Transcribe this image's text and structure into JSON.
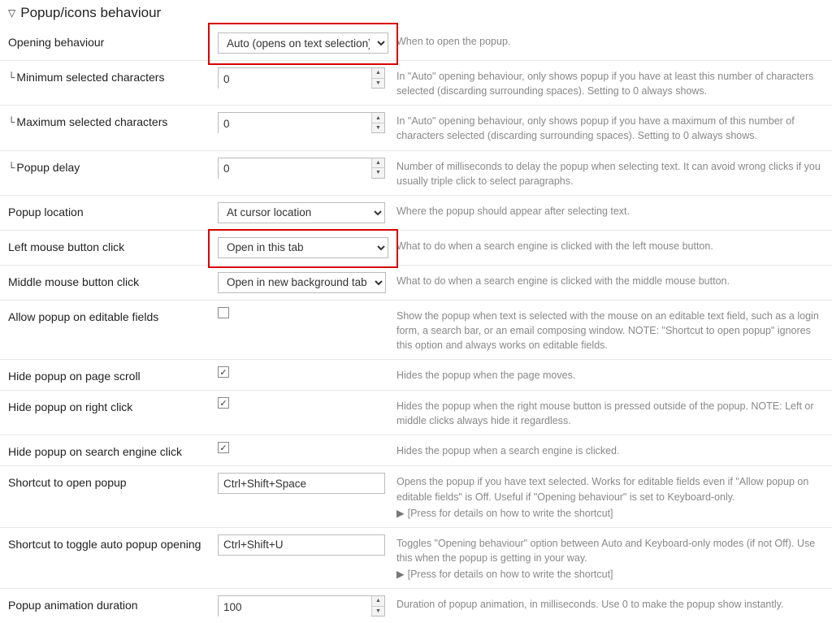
{
  "section": {
    "title": "Popup/icons behaviour"
  },
  "rows": {
    "opening": {
      "label": "Opening behaviour",
      "value": "Auto (opens on text selection)",
      "desc": "When to open the popup."
    },
    "minchars": {
      "label": "Minimum selected characters",
      "value": "0",
      "desc": "In \"Auto\" opening behaviour, only shows popup if you have at least this number of characters selected (discarding surrounding spaces). Setting to 0 always shows."
    },
    "maxchars": {
      "label": "Maximum selected characters",
      "value": "0",
      "desc": "In \"Auto\" opening behaviour, only shows popup if you have a maximum of this number of characters selected (discarding surrounding spaces). Setting to 0 always shows."
    },
    "delay": {
      "label": "Popup delay",
      "value": "0",
      "desc": "Number of milliseconds to delay the popup when selecting text. It can avoid wrong clicks if you usually triple click to select paragraphs."
    },
    "location": {
      "label": "Popup location",
      "value": "At cursor location",
      "desc": "Where the popup should appear after selecting text."
    },
    "leftclick": {
      "label": "Left mouse button click",
      "value": "Open in this tab",
      "desc": "What to do when a search engine is clicked with the left mouse button."
    },
    "middleclick": {
      "label": "Middle mouse button click",
      "value": "Open in new background tab",
      "desc": "What to do when a search engine is clicked with the middle mouse button."
    },
    "allowedit": {
      "label": "Allow popup on editable fields",
      "checked": false,
      "desc": "Show the popup when text is selected with the mouse on an editable text field, such as a login form, a search bar, or an email composing window. NOTE: \"Shortcut to open popup\" ignores this option and always works on editable fields."
    },
    "hidescroll": {
      "label": "Hide popup on page scroll",
      "checked": true,
      "desc": "Hides the popup when the page moves."
    },
    "hideright": {
      "label": "Hide popup on right click",
      "checked": true,
      "desc": "Hides the popup when the right mouse button is pressed outside of the popup. NOTE: Left or middle clicks always hide it regardless."
    },
    "hidesearch": {
      "label": "Hide popup on search engine click",
      "checked": true,
      "desc": "Hides the popup when a search engine is clicked."
    },
    "shortcutopen": {
      "label": "Shortcut to open popup",
      "value": "Ctrl+Shift+Space",
      "desc": "Opens the popup if you have text selected. Works for editable fields even if \"Allow popup on editable fields\" is Off. Useful if \"Opening behaviour\" is set to Keyboard-only.",
      "hint": "[Press for details on how to write the shortcut]"
    },
    "shortcuttoggle": {
      "label": "Shortcut to toggle auto popup opening",
      "value": "Ctrl+Shift+U",
      "desc": "Toggles \"Opening behaviour\" option between Auto and Keyboard-only modes (if not Off). Use this when the popup is getting in your way.",
      "hint": "[Press for details on how to write the shortcut]"
    },
    "animdur": {
      "label": "Popup animation duration",
      "value": "100",
      "desc": "Duration of popup animation, in milliseconds. Use 0 to make the popup show instantly."
    }
  },
  "glyph": {
    "sub": "└",
    "check": "✓"
  }
}
